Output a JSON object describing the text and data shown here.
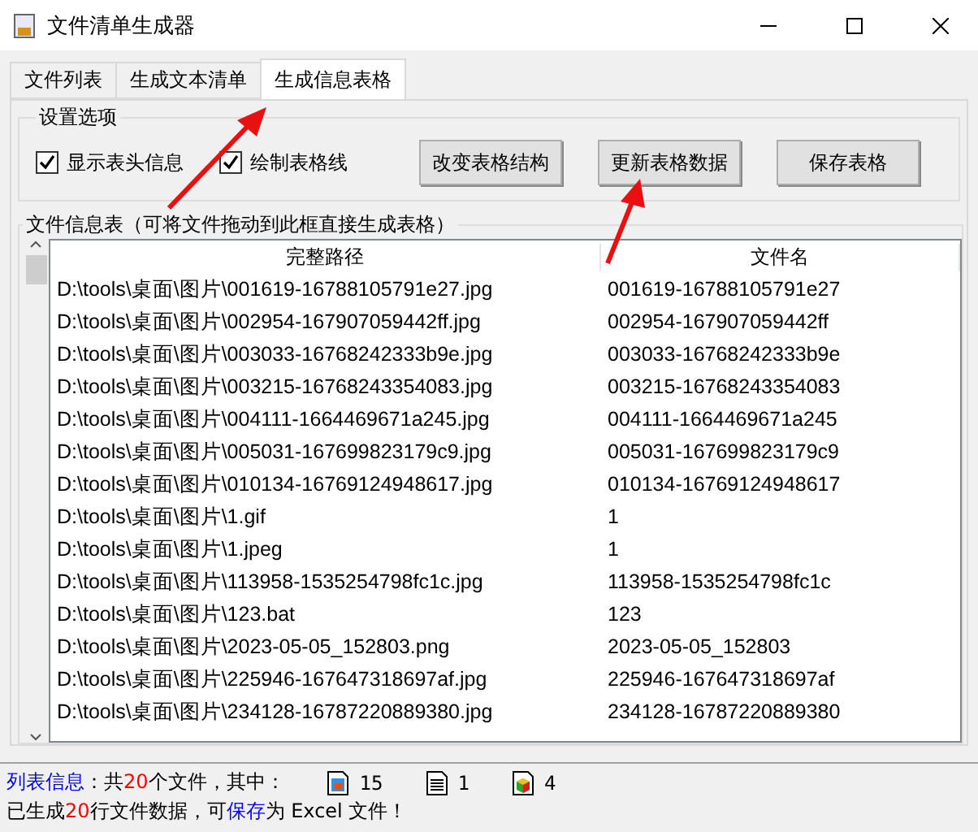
{
  "window": {
    "title": "文件清单生成器"
  },
  "tabs": [
    {
      "label": "文件列表",
      "selected": false
    },
    {
      "label": "生成文本清单",
      "selected": false
    },
    {
      "label": "生成信息表格",
      "selected": true
    }
  ],
  "settings": {
    "title": "设置选项",
    "checkboxes": [
      {
        "label": "显示表头信息",
        "checked": true
      },
      {
        "label": "绘制表格线",
        "checked": true
      }
    ],
    "buttons": [
      "改变表格结构",
      "更新表格数据",
      "保存表格"
    ]
  },
  "table": {
    "title": "文件信息表（可将文件拖动到此框直接生成表格）",
    "columns": [
      "完整路径",
      "文件名"
    ],
    "rows": [
      [
        "D:\\tools\\桌面\\图片\\001619-16788105791e27.jpg",
        "001619-16788105791e27"
      ],
      [
        "D:\\tools\\桌面\\图片\\002954-167907059442ff.jpg",
        "002954-167907059442ff"
      ],
      [
        "D:\\tools\\桌面\\图片\\003033-16768242333b9e.jpg",
        "003033-16768242333b9e"
      ],
      [
        "D:\\tools\\桌面\\图片\\003215-16768243354083.jpg",
        "003215-16768243354083"
      ],
      [
        "D:\\tools\\桌面\\图片\\004111-1664469671a245.jpg",
        "004111-1664469671a245"
      ],
      [
        "D:\\tools\\桌面\\图片\\005031-167699823179c9.jpg",
        "005031-167699823179c9"
      ],
      [
        "D:\\tools\\桌面\\图片\\010134-16769124948617.jpg",
        "010134-16769124948617"
      ],
      [
        "D:\\tools\\桌面\\图片\\1.gif",
        "1"
      ],
      [
        "D:\\tools\\桌面\\图片\\1.jpeg",
        "1"
      ],
      [
        "D:\\tools\\桌面\\图片\\113958-1535254798fc1c.jpg",
        "113958-1535254798fc1c"
      ],
      [
        "D:\\tools\\桌面\\图片\\123.bat",
        "123"
      ],
      [
        "D:\\tools\\桌面\\图片\\2023-05-05_152803.png",
        "2023-05-05_152803"
      ],
      [
        "D:\\tools\\桌面\\图片\\225946-167647318697af.jpg",
        "225946-167647318697af"
      ],
      [
        "D:\\tools\\桌面\\图片\\234128-16787220889380.jpg",
        "234128-16787220889380"
      ]
    ]
  },
  "status": {
    "line_1": [
      {
        "text": "列表信息",
        "color": "#0000ff"
      },
      {
        "text": "：共",
        "color": "#000000"
      },
      {
        "text": "20",
        "color": "#ff0000"
      },
      {
        "text": "个文件，其中：",
        "color": "#000000"
      }
    ],
    "counts": [
      {
        "kind": "image",
        "count": "15"
      },
      {
        "kind": "text",
        "count": "1"
      },
      {
        "kind": "program",
        "count": "4"
      }
    ],
    "line_2": [
      {
        "text": "已生成",
        "color": "#000000"
      },
      {
        "text": "20",
        "color": "#ff0000"
      },
      {
        "text": "行文件数据，可",
        "color": "#000000"
      },
      {
        "text": "保存",
        "color": "#0000ff"
      },
      {
        "text": "为 Excel 文件！",
        "color": "#000000"
      }
    ]
  }
}
